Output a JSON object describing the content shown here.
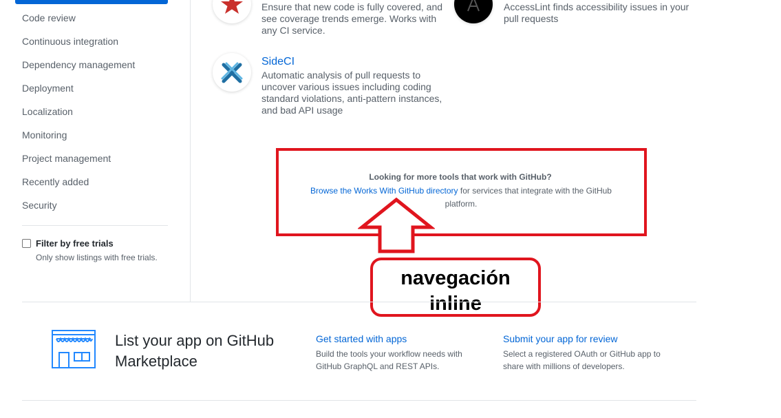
{
  "sidebar": {
    "items": [
      {
        "label": "Code review"
      },
      {
        "label": "Continuous integration"
      },
      {
        "label": "Dependency management"
      },
      {
        "label": "Deployment"
      },
      {
        "label": "Localization"
      },
      {
        "label": "Monitoring"
      },
      {
        "label": "Project management"
      },
      {
        "label": "Recently added"
      },
      {
        "label": "Security"
      }
    ],
    "filter": {
      "title": "Filter by free trials",
      "description": "Only show listings with free trials.",
      "checked": false
    }
  },
  "listings": [
    {
      "icon": "star-icon",
      "title": "",
      "description": "Ensure that new code is fully covered, and see coverage trends emerge. Works with any CI service."
    },
    {
      "icon": "accesslint-icon",
      "title": "",
      "description": "AccessLint finds accessibility issues in your pull requests"
    },
    {
      "icon": "sideci-icon",
      "title": "SideCI",
      "description": "Automatic analysis of pull requests to uncover various issues including coding standard violations, anti-pattern instances, and bad API usage"
    }
  ],
  "more_tools": {
    "title": "Looking for more tools that work with GitHub?",
    "link_text": "Browse the Works With GitHub directory",
    "suffix_text": " for services that integrate with the GitHub platform."
  },
  "annotation": {
    "label": "navegación inline",
    "color": "#e0151e"
  },
  "footer": {
    "title": "List your app on GitHub Marketplace",
    "icon": "storefront-icon",
    "columns": [
      {
        "link": "Get started with apps",
        "description": "Build the tools your workflow needs with GitHub GraphQL and REST APIs."
      },
      {
        "link": "Submit your app for review",
        "description": "Select a registered OAuth or GitHub app to share with millions of developers."
      }
    ]
  },
  "colors": {
    "link": "#0366d6",
    "text_muted": "#586069",
    "annotation": "#e0151e"
  }
}
